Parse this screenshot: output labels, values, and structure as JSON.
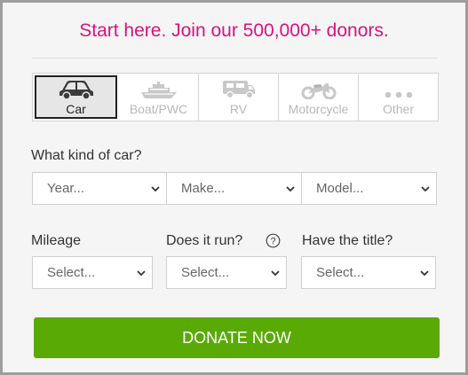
{
  "headline": "Start here. Join our 500,000+ donors.",
  "vehicle_types": [
    {
      "label": "Car",
      "icon": "car-icon",
      "selected": true
    },
    {
      "label": "Boat/PWC",
      "icon": "boat-icon",
      "selected": false
    },
    {
      "label": "RV",
      "icon": "rv-icon",
      "selected": false
    },
    {
      "label": "Motorcycle",
      "icon": "motorcycle-icon",
      "selected": false
    },
    {
      "label": "Other",
      "icon": "more-dots-icon",
      "selected": false
    }
  ],
  "car_question": "What kind of car?",
  "car_selects": {
    "year": "Year...",
    "make": "Make...",
    "model": "Model..."
  },
  "mileage": {
    "label": "Mileage",
    "value": "Select..."
  },
  "runs": {
    "label": "Does it run?",
    "value": "Select...",
    "help_icon": "question-circle-icon"
  },
  "title": {
    "label": "Have the title?",
    "value": "Select..."
  },
  "donate_button": "DONATE NOW",
  "colors": {
    "headline": "#d8127b",
    "donate_bg": "#5aaa06",
    "frame_bg": "#f5f5f5"
  }
}
